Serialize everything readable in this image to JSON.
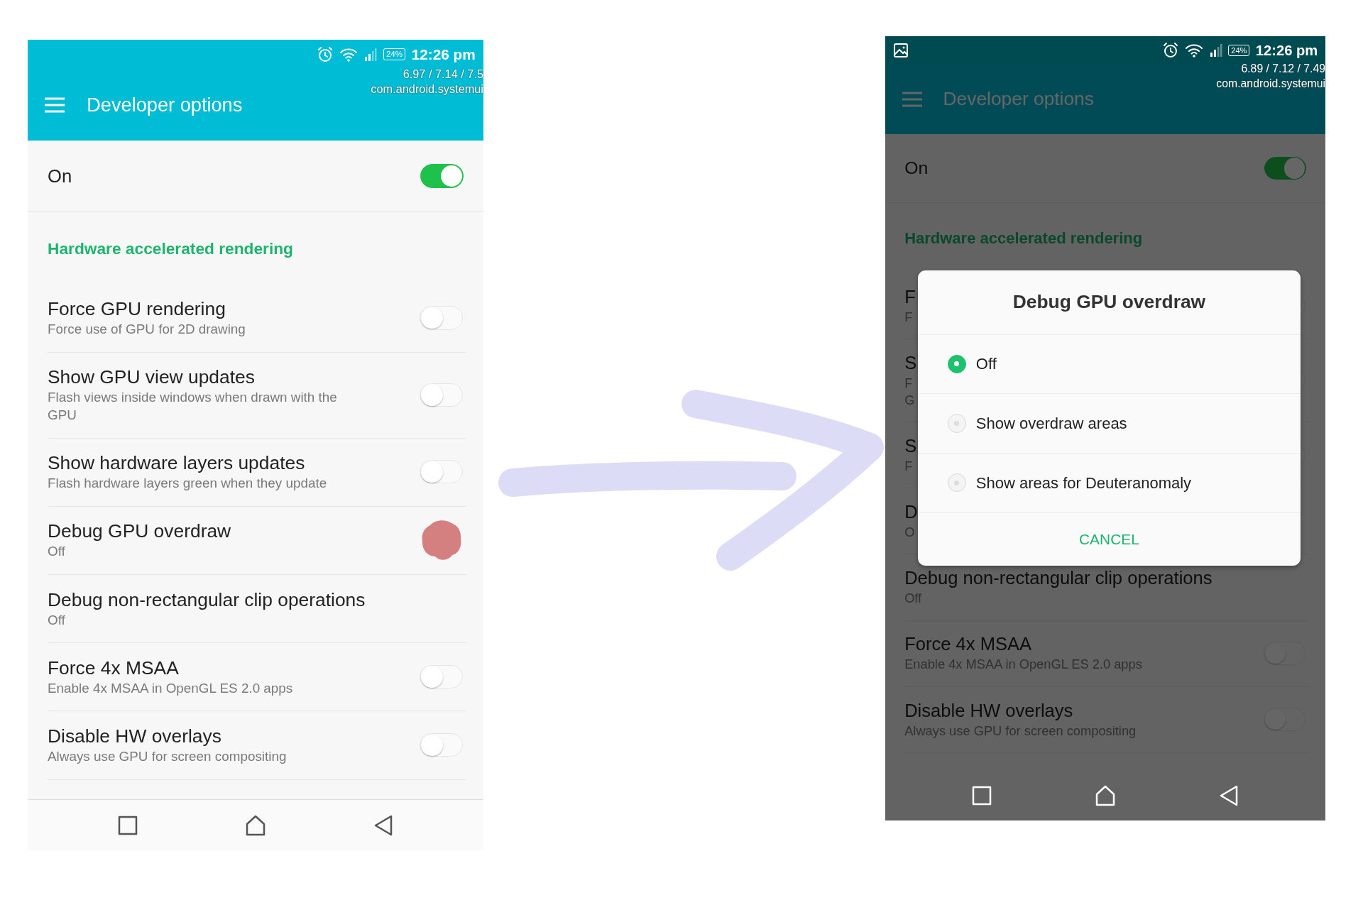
{
  "screens": [
    {
      "screenshot_notice": false,
      "status_bar": {
        "battery": "24%",
        "time": "12:26 pm"
      },
      "gpu_overlay": [
        "6.97 / 7.14 / 7.5",
        "com.android.systemui"
      ],
      "app_bar": {
        "title": "Developer options"
      },
      "master_switch": {
        "label": "On",
        "on": true
      },
      "section_header": "Hardware accelerated rendering",
      "settings": [
        {
          "kind": "toggle",
          "title": "Force GPU rendering",
          "summary": "Force use of GPU for 2D drawing",
          "on": false
        },
        {
          "kind": "toggle",
          "title": "Show GPU view updates",
          "summary": "Flash views inside windows when drawn with the GPU",
          "on": false
        },
        {
          "kind": "toggle",
          "title": "Show hardware layers updates",
          "summary": "Flash hardware layers green when they update",
          "on": false
        },
        {
          "kind": "scribbled",
          "title": "Debug GPU overdraw",
          "summary": "Off"
        },
        {
          "kind": "value",
          "title": "Debug non-rectangular clip operations",
          "summary": "Off"
        },
        {
          "kind": "toggle",
          "title": "Force 4x MSAA",
          "summary": "Enable 4x MSAA in OpenGL ES 2.0 apps",
          "on": false
        },
        {
          "kind": "toggle",
          "title": "Disable HW overlays",
          "summary": "Always use GPU for screen compositing",
          "on": false
        }
      ]
    },
    {
      "screenshot_notice": true,
      "status_bar": {
        "battery": "24%",
        "time": "12:26 pm"
      },
      "gpu_overlay": [
        "6.89 / 7.12 / 7.49",
        "com.android.systemui"
      ],
      "app_bar": {
        "title": "Developer options"
      },
      "master_switch": {
        "label": "On",
        "on": true
      },
      "section_header": "Hardware accelerated rendering",
      "settings": [
        {
          "kind": "toggle",
          "title": "F",
          "summary": "F",
          "on": false
        },
        {
          "kind": "toggle",
          "title": "S",
          "summary": "F\nG",
          "on": false
        },
        {
          "kind": "toggle",
          "title": "S",
          "summary": "F",
          "on": false
        },
        {
          "kind": "value",
          "title": "D",
          "summary": "O"
        },
        {
          "kind": "value",
          "title": "Debug non-rectangular clip operations",
          "summary": "Off"
        },
        {
          "kind": "toggle",
          "title": "Force 4x MSAA",
          "summary": "Enable 4x MSAA in OpenGL ES 2.0 apps",
          "on": false
        },
        {
          "kind": "toggle",
          "title": "Disable HW overlays",
          "summary": "Always use GPU for screen compositing",
          "on": false
        }
      ],
      "dialog": {
        "title": "Debug GPU overdraw",
        "options": [
          {
            "label": "Off",
            "selected": true
          },
          {
            "label": "Show overdraw areas",
            "selected": false
          },
          {
            "label": "Show areas for Deuteranomaly",
            "selected": false
          }
        ],
        "button": "CANCEL"
      }
    }
  ]
}
